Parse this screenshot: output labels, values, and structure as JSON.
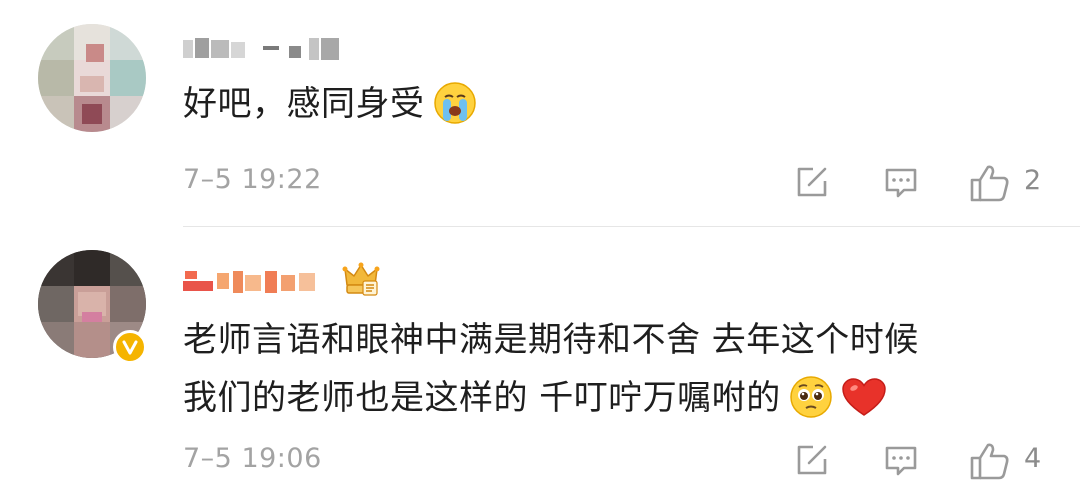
{
  "comments": [
    {
      "avatar_icon": "user-avatar-pixelated",
      "verified": false,
      "text_lines": [
        "好吧，感同身受"
      ],
      "emojis": [
        "crying-face-emoji"
      ],
      "time": "7–5 19:22",
      "like_count": "2"
    },
    {
      "avatar_icon": "user-avatar-pixelated",
      "verified": true,
      "badge_icon": "vip-crown-icon",
      "text_lines": [
        "老师言语和眼神中满是期待和不舍 去年这个时候",
        "我们的老师也是这样的 千叮咛万嘱咐的"
      ],
      "emojis": [
        "pleading-face-emoji",
        "red-heart-emoji"
      ],
      "time": "7–5 19:06",
      "like_count": "4"
    }
  ],
  "colors": {
    "text": "#1e1e1e",
    "meta": "#a3a3a3",
    "icon": "#9a9a9a",
    "divider": "#e6e6e6",
    "verified": "#f5b400",
    "username_redacted": "#f08a5d"
  }
}
